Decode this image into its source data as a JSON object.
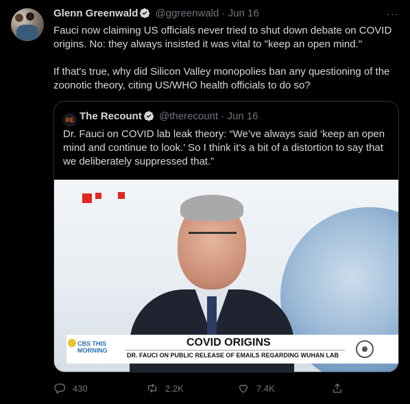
{
  "tweet": {
    "name": "Glenn Greenwald",
    "handle": "@ggreenwald",
    "separator": "·",
    "date": "Jun 16",
    "more": "···",
    "paragraphs": [
      "Fauci now claiming US officials never tried to shut down debate on COVID origins. No: they always insisted it was vital to \"keep an open mind.\"",
      "If that's true, why did Silicon Valley monopolies ban any questioning of the zoonotic theory, citing US/WHO health officials to do so?"
    ]
  },
  "quote": {
    "avatar_text": "RE",
    "name": "The Recount",
    "handle": "@therecount",
    "separator": "·",
    "date": "Jun 16",
    "text": "Dr. Fauci on COVID lab leak theory: “We’ve always said ‘keep an open mind and continue to look.’ So I think it’s a bit of a distortion to say that we deliberately suppressed that.”",
    "video": {
      "logo_line1": "CBS THIS",
      "logo_line2": "MORNING",
      "headline": "COVID ORIGINS",
      "subline": "DR. FAUCI ON PUBLIC RELEASE OF EMAILS REGARDING WUHAN LAB"
    }
  },
  "actions": {
    "replies": "430",
    "retweets": "2.2K",
    "likes": "7.4K"
  },
  "colors": {
    "background": "#000000",
    "text": "#d9d9d9",
    "muted": "#6e767d",
    "border": "#2f3336",
    "verified": "#d9d9d9"
  }
}
